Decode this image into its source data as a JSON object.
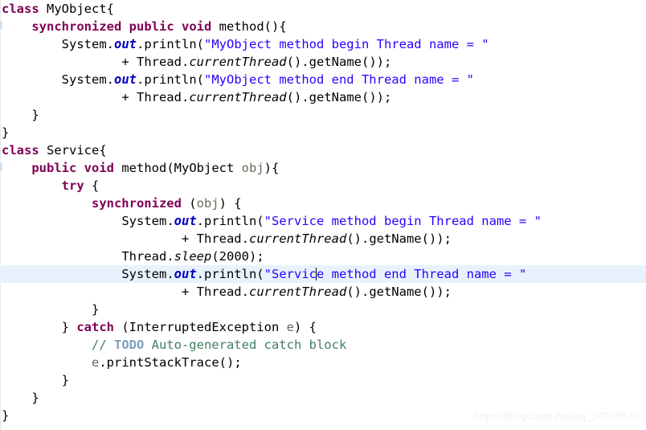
{
  "editor": {
    "language": "java",
    "theme": "eclipse-light",
    "background": "#ffffff",
    "current_line_highlight": "#e8f2fd",
    "colors": {
      "keyword": "#7f0055",
      "string": "#2a00ff",
      "static_field": "#0000c0",
      "comment": "#3f7f5f",
      "todo_tag": "#7f9fbf",
      "parameter": "#6a6a5a",
      "plain": "#000000"
    },
    "caret": {
      "line": 16,
      "after_text": "System.out.println(\"Servic",
      "visible": true
    },
    "lines": [
      {
        "n": 1,
        "indent": 0,
        "text": "class MyObject{"
      },
      {
        "n": 2,
        "indent": 1,
        "text": "synchronized public void method(){"
      },
      {
        "n": 3,
        "indent": 2,
        "text": "System.out.println(\"MyObject method begin Thread name = \""
      },
      {
        "n": 4,
        "indent": 4,
        "text": "+ Thread.currentThread().getName());"
      },
      {
        "n": 5,
        "indent": 2,
        "text": "System.out.println(\"MyObject method end Thread name = \""
      },
      {
        "n": 6,
        "indent": 4,
        "text": "+ Thread.currentThread().getName());"
      },
      {
        "n": 7,
        "indent": 1,
        "text": "}"
      },
      {
        "n": 8,
        "indent": 0,
        "text": "}"
      },
      {
        "n": 9,
        "indent": 0,
        "text": "class Service{"
      },
      {
        "n": 10,
        "indent": 1,
        "text": "public void method(MyObject obj){"
      },
      {
        "n": 11,
        "indent": 2,
        "text": "try {"
      },
      {
        "n": 12,
        "indent": 3,
        "text": "synchronized (obj) {"
      },
      {
        "n": 13,
        "indent": 4,
        "text": "System.out.println(\"Service method begin Thread name = \""
      },
      {
        "n": 14,
        "indent": 6,
        "text": "+ Thread.currentThread().getName());"
      },
      {
        "n": 15,
        "indent": 4,
        "text": "Thread.sleep(2000);"
      },
      {
        "n": 16,
        "indent": 4,
        "text": "System.out.println(\"Service method end Thread name = \""
      },
      {
        "n": 17,
        "indent": 6,
        "text": "+ Thread.currentThread().getName());"
      },
      {
        "n": 18,
        "indent": 3,
        "text": "}"
      },
      {
        "n": 19,
        "indent": 2,
        "text": "} catch (InterruptedException e) {"
      },
      {
        "n": 20,
        "indent": 3,
        "text": "// TODO Auto-generated catch block"
      },
      {
        "n": 21,
        "indent": 3,
        "text": "e.printStackTrace();"
      },
      {
        "n": 22,
        "indent": 2,
        "text": "}"
      },
      {
        "n": 23,
        "indent": 1,
        "text": "}"
      },
      {
        "n": 24,
        "indent": 0,
        "text": "}"
      }
    ],
    "keywords_used": [
      "class",
      "synchronized",
      "public",
      "void",
      "try",
      "catch"
    ],
    "strings_used": [
      "\"MyObject method begin Thread name = \"",
      "\"MyObject method end Thread name = \"",
      "\"Service method begin Thread name = \"",
      "\"Service method end Thread name = \""
    ],
    "identifiers": {
      "class_my_object": "MyObject",
      "class_service": "Service",
      "method_name": "method",
      "parameter_name": "obj",
      "exception_type": "InterruptedException",
      "exception_var": "e",
      "sleep_arg": "2000"
    },
    "comment_text": "// TODO Auto-generated catch block",
    "todo_tag": "TODO"
  },
  "watermark": {
    "text": "https://blog.csdn.net/qq_24099547"
  },
  "tokens": {
    "kw_class": "class",
    "kw_synchronized": "synchronized",
    "kw_public": "public",
    "kw_void": "void",
    "kw_try": "try",
    "kw_catch": "catch",
    "t_myobject": "MyObject",
    "t_service": "Service",
    "t_system": "System",
    "t_out": "out",
    "t_println": "println",
    "t_thread": "Thread",
    "t_currentthread": "currentThread",
    "t_getname": "getName",
    "t_sleep": "sleep",
    "t_obj": "obj",
    "t_e": "e",
    "t_printstacktrace": "printStackTrace",
    "t_interruptedexception": "InterruptedException",
    "n_2000": "2000",
    "s_my_begin": "\"MyObject method begin Thread name = \"",
    "s_my_end": "\"MyObject method end Thread name = \"",
    "s_sv_begin": "\"Service method begin Thread name = \"",
    "s_sv_end_a": "\"Servic",
    "s_sv_end_b": "e method end Thread name = \"",
    "c_todo": "TODO",
    "c_slashes": "// ",
    "c_rest": " Auto-generated catch block",
    "p_method_open": "method(){",
    "p_method_obj": "method(",
    "p_close_brace_open": "){",
    "p_plus": "+ ",
    "p_dot": ".",
    "p_call_close": "().",
    "p_getname_tail": "());",
    "p_sleep_open": "(",
    "p_sleep_close": ");",
    "p_brace_close": "}",
    "p_brace_open": "{",
    "p_sync_obj_open": " (",
    "p_sync_obj_close": ") {",
    "p_catch_open": "} ",
    "p_catch_paren": " (",
    "p_catch_var": " ",
    "p_catch_close": ") {",
    "p_pst_tail": "();",
    "p_class_open": "{",
    "p_println_open": ".println(",
    "p_space": " "
  }
}
